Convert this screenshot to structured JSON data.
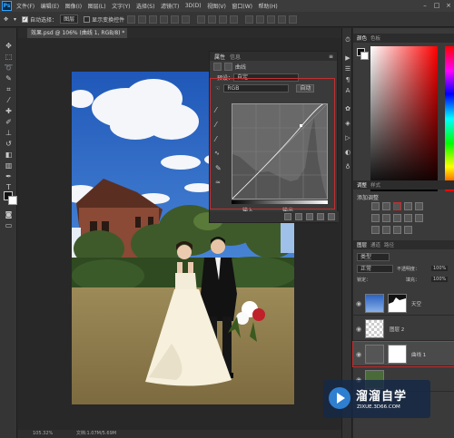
{
  "menubar": {
    "items": [
      "文件(F)",
      "编辑(E)",
      "图像(I)",
      "图层(L)",
      "文字(Y)",
      "选择(S)",
      "滤镜(T)",
      "3D(D)",
      "视图(V)",
      "窗口(W)",
      "帮助(H)"
    ],
    "logo": "Ps"
  },
  "options": {
    "auto_select_label": "自动选择：",
    "auto_select_value": "图层",
    "show_transform_label": "显示变换控件"
  },
  "document": {
    "tab_title": "效果.psd @ 106% (曲线 1, RGB/8) *",
    "zoom": "105.32%",
    "doc_info": "文档:1.07M/5.69M"
  },
  "properties": {
    "tabs": [
      "属性",
      "信息"
    ],
    "panel_name": "曲线",
    "preset_label": "预设：",
    "preset_value": "自定",
    "channel_value": "RGB",
    "auto_label": "自动",
    "input_label": "输入：",
    "output_label": "输出："
  },
  "color_panel": {
    "tabs": [
      "颜色",
      "色板"
    ]
  },
  "adjustments": {
    "tabs": [
      "调整",
      "样式"
    ],
    "title": "添加调整"
  },
  "layers": {
    "tabs": [
      "图层",
      "通道",
      "路径"
    ],
    "kind_filter": "类型",
    "blend_mode": "正常",
    "opacity_label": "不透明度：",
    "opacity_value": "100%",
    "lock_label": "锁定：",
    "fill_label": "填充：",
    "fill_value": "100%",
    "items": [
      {
        "name": "天空"
      },
      {
        "name": "图层 2"
      },
      {
        "name": "曲线 1"
      }
    ]
  },
  "watermark": {
    "title": "溜溜自学",
    "url": "ZIXUE.3D66.COM"
  },
  "colors": {
    "accent_red": "#c03030",
    "ui_dark": "#282828",
    "ps_blue": "#31a8ff"
  }
}
